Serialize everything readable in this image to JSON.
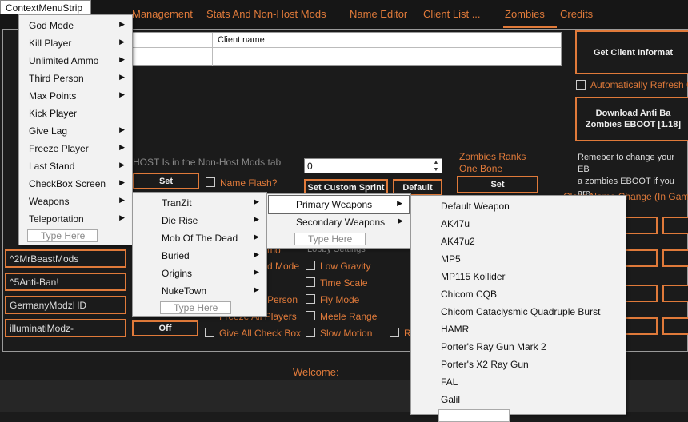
{
  "tabs": [
    "Management",
    "Stats And Non-Host Mods",
    "Name Editor",
    "Client List ...",
    "Zombies",
    "Credits"
  ],
  "grid": {
    "col_client_name": "Client name"
  },
  "right": {
    "get_client_info": "Get Client Informat",
    "auto_refresh": "Automatically Refresh C",
    "download_anti_ban": "Download Anti Ba\nZombies EBOOT  [1.18]",
    "note": "Remeber to change your EB\na zombies EBOOT if you are\non zombies",
    "class_name_change": "Class Name Change (In Game)"
  },
  "host_note": "HOST Is in the Non-Host Mods tab",
  "set_label": "Set",
  "name_flash": "Name Flash?",
  "sprint_value": "0",
  "set_custom_sprint": "Set Custom Sprint",
  "default_label": "Default",
  "zombies_ranks": "Zombies Ranks",
  "one_bone": "One Bone",
  "lobby_settings": "Lobby Settings",
  "checkboxes_left": [
    "Give All Check Box"
  ],
  "checkboxes_mid": [
    "Low Gravity",
    "Time Scale",
    "Fly Mode",
    "Meele Range",
    "Slow Motion"
  ],
  "partial_labels": {
    "ammo": "mo",
    "god_mode": "d Mode",
    "person": "Person",
    "all_players": "Freeze All Players",
    "ra": "Ra"
  },
  "names": [
    "^2MrBeastMods",
    "^5Anti-Ban!",
    "GermanyModzHD",
    "illuminatiModz-"
  ],
  "off_label": "Off",
  "welcome": "Welcome:",
  "context_title": "ContextMenuStrip",
  "menu1": [
    "God Mode",
    "Kill Player",
    "Unlimited Ammo",
    "Third Person",
    "Max Points",
    "Kick Player",
    "Give Lag",
    "Freeze Player",
    "Last Stand",
    "CheckBox Screen",
    "Weapons",
    "Teleportation"
  ],
  "menu2": [
    "TranZit",
    "Die Rise",
    "Mob Of The Dead",
    "Buried",
    "Origins",
    "NukeTown"
  ],
  "menu3": [
    "Primary Weapons",
    "Secondary Weapons"
  ],
  "menu4": [
    "Default Weapon",
    "AK47u",
    "AK47u2",
    "MP5",
    "MP115 Kollider",
    "Chicom CQB",
    "Chicom Cataclysmic Quadruple Burst",
    "HAMR",
    "Porter's Ray Gun Mark 2",
    "Porter's X2 Ray Gun",
    "FAL",
    "Galil"
  ],
  "type_here": "Type Here"
}
